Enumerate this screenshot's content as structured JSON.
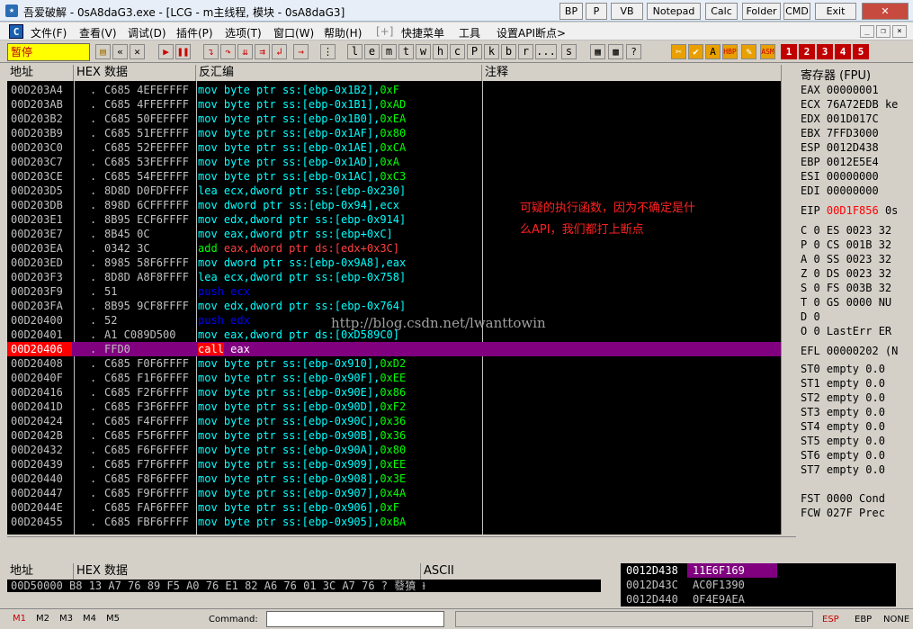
{
  "window": {
    "title": "吾爱破解 - 0sA8daG3.exe - [LCG - m主线程, 模块 - 0sA8daG3]",
    "title_buttons": [
      "BP",
      "P",
      "VB",
      "Notepad",
      "Calc",
      "Folder",
      "CMD",
      "Exit"
    ]
  },
  "menu": {
    "items": [
      "文件(F)",
      "查看(V)",
      "调试(D)",
      "插件(P)",
      "选项(T)",
      "窗口(W)",
      "帮助(H)",
      "[+]",
      "快捷菜单",
      "工具",
      "设置API断点>"
    ]
  },
  "toolbar": {
    "status": "暂停",
    "letters": [
      "l",
      "e",
      "m",
      "t",
      "w",
      "h",
      "c",
      "P",
      "k",
      "b",
      "r",
      "...",
      "s"
    ],
    "right_labels": [
      "1",
      "2",
      "3",
      "4",
      "5"
    ]
  },
  "cpu": {
    "headers": {
      "addr": "地址",
      "hex": "HEX 数据",
      "disasm": "反汇编",
      "comment": "注释"
    },
    "rows": [
      {
        "addr": "00D203A4",
        "dot": ".",
        "hex": "C685 4EFEFFFF",
        "op": "mov",
        "args": "byte ptr ss:[ebp-0x1B2],",
        "imm": "0xF"
      },
      {
        "addr": "00D203AB",
        "dot": ".",
        "hex": "C685 4FFEFFFF",
        "op": "mov",
        "args": "byte ptr ss:[ebp-0x1B1],",
        "imm": "0xAD"
      },
      {
        "addr": "00D203B2",
        "dot": ".",
        "hex": "C685 50FEFFFF",
        "op": "mov",
        "args": "byte ptr ss:[ebp-0x1B0],",
        "imm": "0xEA"
      },
      {
        "addr": "00D203B9",
        "dot": ".",
        "hex": "C685 51FEFFFF",
        "op": "mov",
        "args": "byte ptr ss:[ebp-0x1AF],",
        "imm": "0x80"
      },
      {
        "addr": "00D203C0",
        "dot": ".",
        "hex": "C685 52FEFFFF",
        "op": "mov",
        "args": "byte ptr ss:[ebp-0x1AE],",
        "imm": "0xCA"
      },
      {
        "addr": "00D203C7",
        "dot": ".",
        "hex": "C685 53FEFFFF",
        "op": "mov",
        "args": "byte ptr ss:[ebp-0x1AD],",
        "imm": "0xA"
      },
      {
        "addr": "00D203CE",
        "dot": ".",
        "hex": "C685 54FEFFFF",
        "op": "mov",
        "args": "byte ptr ss:[ebp-0x1AC],",
        "imm": "0xC3"
      },
      {
        "addr": "00D203D5",
        "dot": ".",
        "hex": "8D8D D0FDFFFF",
        "op": "lea",
        "args": "ecx,dword ptr ss:[ebp-0x230]",
        "imm": ""
      },
      {
        "addr": "00D203DB",
        "dot": ".",
        "hex": "898D 6CFFFFFF",
        "op": "mov",
        "args": "dword ptr ss:[ebp-0x94],ecx",
        "imm": ""
      },
      {
        "addr": "00D203E1",
        "dot": ".",
        "hex": "8B95 ECF6FFFF",
        "op": "mov",
        "args": "edx,dword ptr ss:[ebp-0x914]",
        "imm": ""
      },
      {
        "addr": "00D203E7",
        "dot": ".",
        "hex": "8B45 0C",
        "op": "mov",
        "args": "eax,dword ptr ss:[ebp+0xC]",
        "imm": ""
      },
      {
        "addr": "00D203EA",
        "dot": ".",
        "hex": "0342 3C",
        "op": "add",
        "args": "eax,dword ptr ds:[edx+0x3C]",
        "imm": ""
      },
      {
        "addr": "00D203ED",
        "dot": ".",
        "hex": "8985 58F6FFFF",
        "op": "mov",
        "args": "dword ptr ss:[ebp-0x9A8],eax",
        "imm": ""
      },
      {
        "addr": "00D203F3",
        "dot": ".",
        "hex": "8D8D A8F8FFFF",
        "op": "lea",
        "args": "ecx,dword ptr ss:[ebp-0x758]",
        "imm": ""
      },
      {
        "addr": "00D203F9",
        "dot": ".",
        "hex": "51",
        "op": "push",
        "args": "ecx",
        "imm": ""
      },
      {
        "addr": "00D203FA",
        "dot": ".",
        "hex": "8B95 9CF8FFFF",
        "op": "mov",
        "args": "edx,dword ptr ss:[ebp-0x764]",
        "imm": ""
      },
      {
        "addr": "00D20400",
        "dot": ".",
        "hex": "52",
        "op": "push",
        "args": "edx",
        "imm": ""
      },
      {
        "addr": "00D20401",
        "dot": ".",
        "hex": "A1 C089D500",
        "op": "mov",
        "args": "eax,dword ptr ds:[0xD589C0]",
        "imm": ""
      },
      {
        "addr": "00D20406",
        "dot": ".",
        "hex": "FFD0",
        "op": "call",
        "args": "eax",
        "imm": "",
        "selected": true
      },
      {
        "addr": "00D20408",
        "dot": ".",
        "hex": "C685 F0F6FFFF",
        "op": "mov",
        "args": "byte ptr ss:[ebp-0x910],",
        "imm": "0xD2"
      },
      {
        "addr": "00D2040F",
        "dot": ".",
        "hex": "C685 F1F6FFFF",
        "op": "mov",
        "args": "byte ptr ss:[ebp-0x90F],",
        "imm": "0xEE"
      },
      {
        "addr": "00D20416",
        "dot": ".",
        "hex": "C685 F2F6FFFF",
        "op": "mov",
        "args": "byte ptr ss:[ebp-0x90E],",
        "imm": "0x86"
      },
      {
        "addr": "00D2041D",
        "dot": ".",
        "hex": "C685 F3F6FFFF",
        "op": "mov",
        "args": "byte ptr ss:[ebp-0x90D],",
        "imm": "0xF2"
      },
      {
        "addr": "00D20424",
        "dot": ".",
        "hex": "C685 F4F6FFFF",
        "op": "mov",
        "args": "byte ptr ss:[ebp-0x90C],",
        "imm": "0x36"
      },
      {
        "addr": "00D2042B",
        "dot": ".",
        "hex": "C685 F5F6FFFF",
        "op": "mov",
        "args": "byte ptr ss:[ebp-0x90B],",
        "imm": "0x36"
      },
      {
        "addr": "00D20432",
        "dot": ".",
        "hex": "C685 F6F6FFFF",
        "op": "mov",
        "args": "byte ptr ss:[ebp-0x90A],",
        "imm": "0x80"
      },
      {
        "addr": "00D20439",
        "dot": ".",
        "hex": "C685 F7F6FFFF",
        "op": "mov",
        "args": "byte ptr ss:[ebp-0x909],",
        "imm": "0xEE"
      },
      {
        "addr": "00D20440",
        "dot": ".",
        "hex": "C685 F8F6FFFF",
        "op": "mov",
        "args": "byte ptr ss:[ebp-0x908],",
        "imm": "0x3E"
      },
      {
        "addr": "00D20447",
        "dot": ".",
        "hex": "C685 F9F6FFFF",
        "op": "mov",
        "args": "byte ptr ss:[ebp-0x907],",
        "imm": "0x4A"
      },
      {
        "addr": "00D2044E",
        "dot": ".",
        "hex": "C685 FAF6FFFF",
        "op": "mov",
        "args": "byte ptr ss:[ebp-0x906],",
        "imm": "0xF"
      },
      {
        "addr": "00D20455",
        "dot": ".",
        "hex": "C685 FBF6FFFF",
        "op": "mov",
        "args": "byte ptr ss:[ebp-0x905],",
        "imm": "0xBA"
      }
    ],
    "annotation_line1": "可疑的执行函数，因为不确定是什",
    "annotation_line2": "么API，我们都打上断点",
    "watermark": "http://blog.csdn.net/lwanttowin"
  },
  "registers": {
    "title": "寄存器 (FPU)",
    "gp": [
      {
        "name": "EAX",
        "value": "00000001",
        "extra": ""
      },
      {
        "name": "ECX",
        "value": "76A72EDB",
        "extra": "ke"
      },
      {
        "name": "EDX",
        "value": "001D017C",
        "extra": ""
      },
      {
        "name": "EBX",
        "value": "7FFD3000",
        "extra": ""
      },
      {
        "name": "ESP",
        "value": "0012D438",
        "extra": ""
      },
      {
        "name": "EBP",
        "value": "0012E5E4",
        "extra": ""
      },
      {
        "name": "ESI",
        "value": "00000000",
        "extra": ""
      },
      {
        "name": "EDI",
        "value": "00000000",
        "extra": ""
      }
    ],
    "eip": {
      "name": "EIP",
      "value": "00D1F856",
      "extra": "0s"
    },
    "flags": [
      "C 0  ES 0023 32",
      "P 0  CS 001B 32",
      "A 0  SS 0023 32",
      "Z 0  DS 0023 32",
      "S 0  FS 003B 32",
      "T 0  GS 0000 NU",
      "D 0",
      "O 0  LastErr ER"
    ],
    "efl": "EFL 00000202 (N",
    "fpu": [
      "ST0 empty 0.0",
      "ST1 empty 0.0",
      "ST2 empty 0.0",
      "ST3 empty 0.0",
      "ST4 empty 0.0",
      "ST5 empty 0.0",
      "ST6 empty 0.0",
      "ST7 empty 0.0"
    ],
    "fst": "FST 0000  Cond",
    "fcw": "FCW 027F  Prec"
  },
  "dump": {
    "headers": {
      "addr": "地址",
      "hex": "HEX 数据",
      "ascii": "ASCII"
    },
    "row": "00D50000 B8 13 A7 76 89 F5 A0 76 E1 82 A6 76 01 3C A7 76 ?  蕟獖 ⱡ"
  },
  "stack": {
    "rows": [
      {
        "addr": "0012D438",
        "value": "11E6F169",
        "selected": true
      },
      {
        "addr": "0012D43C",
        "value": "AC0F1390",
        "selected": false
      },
      {
        "addr": "0012D440",
        "value": "0F4E9AEA",
        "selected": false
      }
    ]
  },
  "bottom": {
    "tabs": [
      "M1",
      "M2",
      "M3",
      "M4",
      "M5"
    ],
    "command_label": "Command:",
    "right_buttons": [
      "ESP",
      "EBP",
      "NONE"
    ]
  },
  "colors": {
    "selected_row": "#800080",
    "selected_addr": "#ff0000",
    "mov": "#00ffff",
    "push": "#0000ff",
    "add": "#00ff00",
    "annotation": "#ff2222"
  }
}
